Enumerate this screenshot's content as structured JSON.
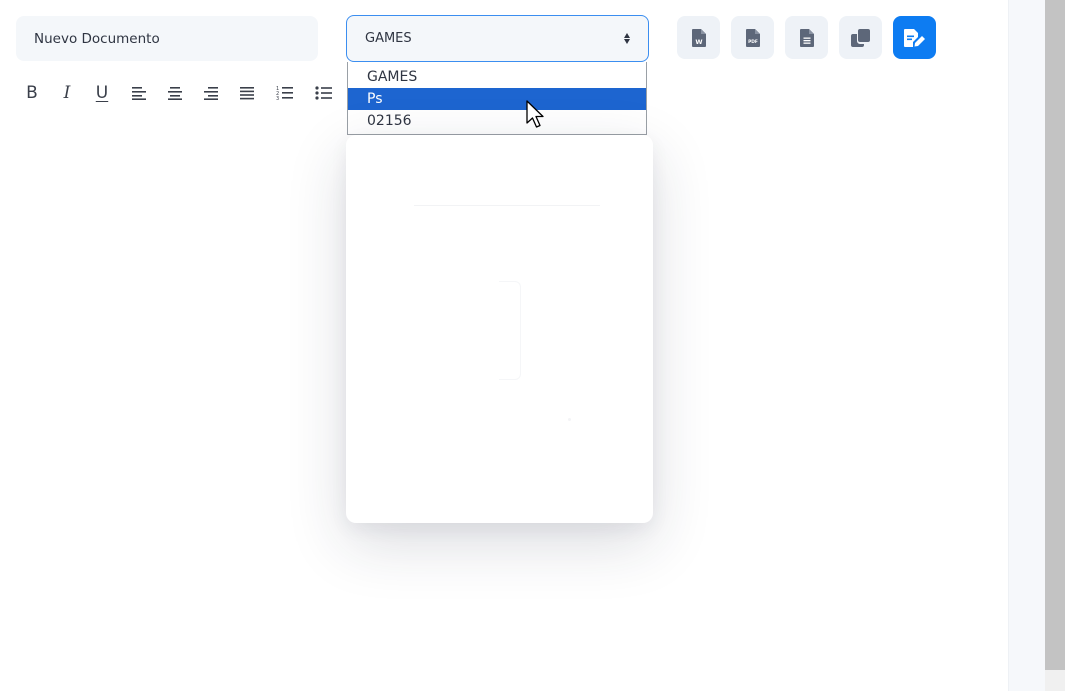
{
  "document": {
    "name_value": "Nuevo Documento"
  },
  "category_select": {
    "selected_value": "GAMES",
    "options": [
      {
        "label": "GAMES",
        "selected": false
      },
      {
        "label": "Ps",
        "selected": true
      },
      {
        "label": "02156",
        "selected": false
      }
    ]
  },
  "actions": [
    {
      "name": "export-word-button",
      "icon": "file-word-icon",
      "glyph": "W"
    },
    {
      "name": "export-pdf-button",
      "icon": "file-pdf-icon",
      "glyph": "PDF"
    },
    {
      "name": "export-text-button",
      "icon": "file-lines-icon"
    },
    {
      "name": "duplicate-button",
      "icon": "copy-icon"
    },
    {
      "name": "save-edit-button",
      "icon": "file-pen-icon"
    }
  ],
  "format_toolbar": {
    "bold_glyph": "B",
    "italic_glyph": "I",
    "underline_glyph": "U"
  },
  "colors": {
    "accent": "#0d7cf2",
    "selected_option": "#1d65d0",
    "input_bg": "#f4f7fa",
    "icon_gray": "#5d6779"
  }
}
